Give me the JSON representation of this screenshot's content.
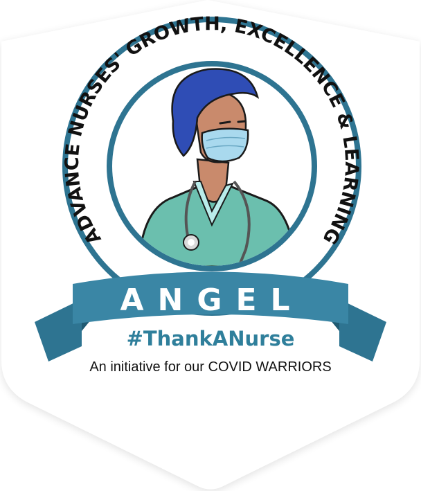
{
  "logo": {
    "arc_text": "ADVANCE NURSES' GROWTH, EXCELLENCE & LEARNING",
    "ribbon_text": "ANGEL",
    "icon": "nurse-with-mask-icon"
  },
  "hashtag": "#ThankANurse",
  "tagline": "An initiative for our COVID WARRIORS",
  "colors": {
    "teal_dark": "#2e7491",
    "teal_ribbon": "#3a86a5",
    "scrubs": "#6bbfae",
    "cap": "#2f4db5",
    "mask": "#a9d9ee",
    "skin": "#c98a6c",
    "text_dark": "#111111"
  }
}
